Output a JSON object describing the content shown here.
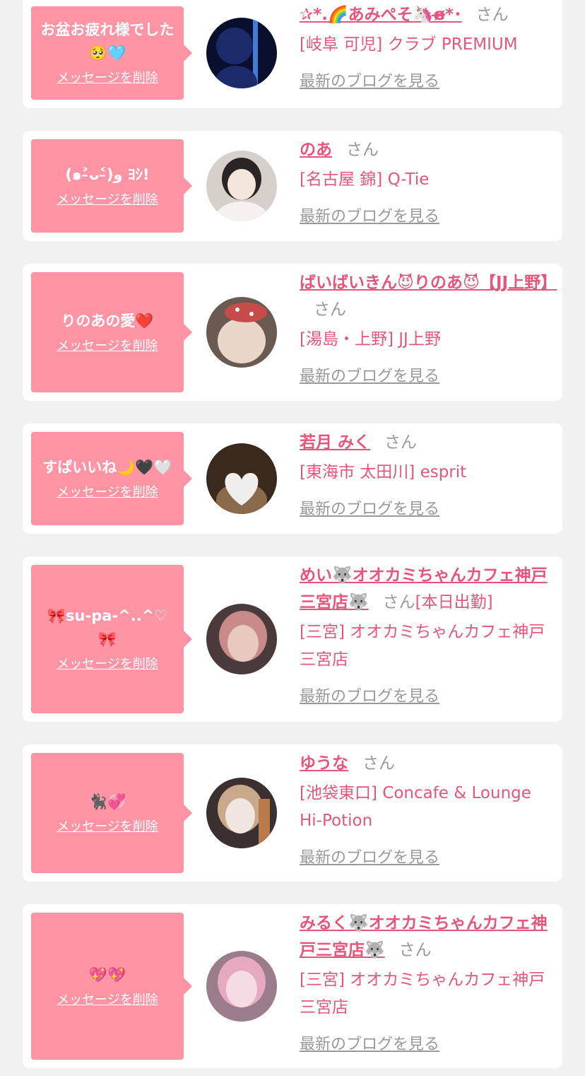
{
  "favorites": [
    {
      "message": "お盆お疲れ様でした🥺🩵",
      "delete_label": "メッセージを削除",
      "name": "✰*.🌈あみぺそ🦄ɞ̴̶̷*･",
      "honorific": "さん",
      "shop": "[岐阜 可児] クラブ PREMIUM",
      "blog_link": "最新のブログを見る",
      "avatar_colors": [
        "#1b2a6b",
        "#3f7dd8",
        "#0a0f2e"
      ]
    },
    {
      "message": "(๑˃̵ᴗ˂̵)و ﾖｼ!",
      "delete_label": "メッセージを削除",
      "name": "のあ",
      "honorific": "さん",
      "shop": "[名古屋 錦] Q-Tie",
      "blog_link": "最新のブログを見る",
      "avatar_colors": [
        "#f4f1ee",
        "#d7cfc9",
        "#2b2424"
      ]
    },
    {
      "message": "りのあの愛❤️",
      "delete_label": "メッセージを削除",
      "name": "ばいばいきん😈りのあ😈【JJ上野】",
      "honorific": "さん",
      "shop": "[湯島・上野] JJ上野",
      "blog_link": "最新のブログを見る",
      "avatar_colors": [
        "#e9d6c8",
        "#c84b4b",
        "#6b5a52"
      ]
    },
    {
      "message": "すぱいいね🌙🖤🤍",
      "delete_label": "メッセージを削除",
      "name": "若月 みく",
      "honorific": "さん",
      "shop": "[東海市 太田川] esprit",
      "blog_link": "最新のブログを見る",
      "avatar_colors": [
        "#3a2a1e",
        "#f0eeec",
        "#8a6a4a"
      ]
    },
    {
      "message": "🎀su-pa-^..^♡🎀",
      "delete_label": "メッセージを削除",
      "name": "めい🐺オオカミちゃんカフェ神戸三宮店🐺",
      "honorific": "さん",
      "status": "[本日出勤]",
      "shop": "[三宮] オオカミちゃんカフェ神戸三宮店",
      "blog_link": "最新のブログを見る",
      "avatar_colors": [
        "#e8c9bf",
        "#4a3a3a",
        "#c98a8a"
      ]
    },
    {
      "message": "🐈‍⬛💞",
      "delete_label": "メッセージを削除",
      "name": "ゆうな",
      "honorific": "さん",
      "shop": "[池袋東口] Concafe & Lounge Hi-Potion",
      "blog_link": "最新のブログを見る",
      "avatar_colors": [
        "#efe6e2",
        "#caa88c",
        "#3a3030"
      ]
    },
    {
      "message": "💖💖",
      "delete_label": "メッセージを削除",
      "name": "みるく🐺オオカミちゃんカフェ神戸三宮店🐺",
      "honorific": "さん",
      "shop": "[三宮] オオカミちゃんカフェ神戸三宮店",
      "blog_link": "最新のブログを見る",
      "avatar_colors": [
        "#f6dbe4",
        "#e6a9c0",
        "#9b7c8a"
      ]
    }
  ]
}
